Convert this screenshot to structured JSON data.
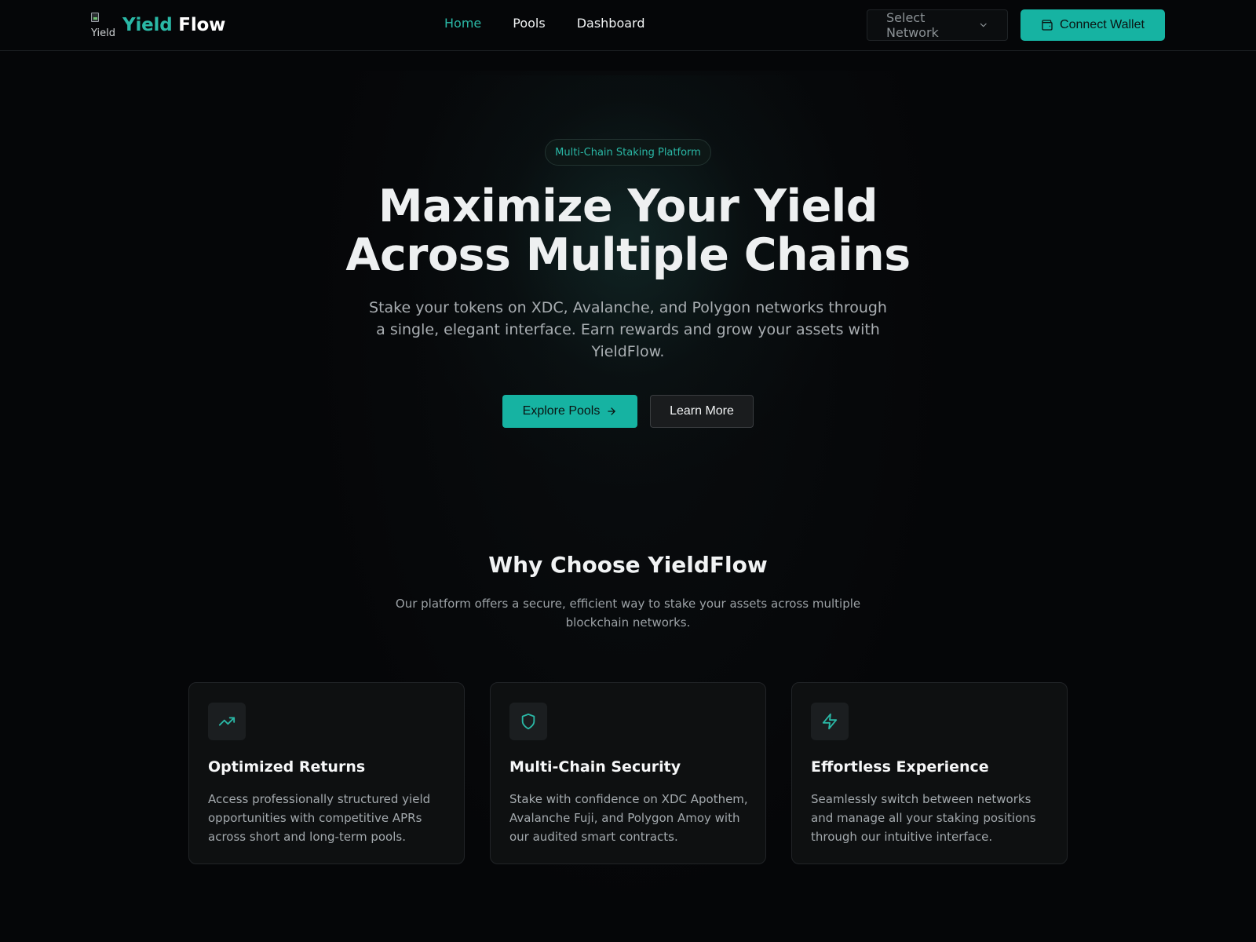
{
  "header": {
    "logo_alt": "Yield",
    "logo_accent": "Yield",
    "logo_rest": " Flow",
    "nav": [
      {
        "label": "Home",
        "active": true
      },
      {
        "label": "Pools",
        "active": false
      },
      {
        "label": "Dashboard",
        "active": false
      }
    ],
    "network_placeholder": "Select Network",
    "connect_label": "Connect Wallet"
  },
  "hero": {
    "badge": "Multi-Chain Staking Platform",
    "title_line1": "Maximize Your Yield",
    "title_line2": "Across Multiple Chains",
    "subtitle": "Stake your tokens on XDC, Avalanche, and Polygon networks through a single, elegant interface. Earn rewards and grow your assets with YieldFlow.",
    "explore_label": "Explore Pools",
    "learn_label": "Learn More"
  },
  "features": {
    "title": "Why Choose YieldFlow",
    "subtitle": "Our platform offers a secure, efficient way to stake your assets across multiple blockchain networks.",
    "cards": [
      {
        "icon": "trending-up-icon",
        "title": "Optimized Returns",
        "desc": "Access professionally structured yield opportunities with competitive APRs across short and long-term pools."
      },
      {
        "icon": "shield-icon",
        "title": "Multi-Chain Security",
        "desc": "Stake with confidence on XDC Apothem, Avalanche Fuji, and Polygon Amoy with our audited smart contracts."
      },
      {
        "icon": "lightning-icon",
        "title": "Effortless Experience",
        "desc": "Seamlessly switch between networks and manage all your staking positions through our intuitive interface."
      }
    ]
  },
  "colors": {
    "accent": "#16b3a2",
    "background": "#050608",
    "card": "#0e1011"
  }
}
